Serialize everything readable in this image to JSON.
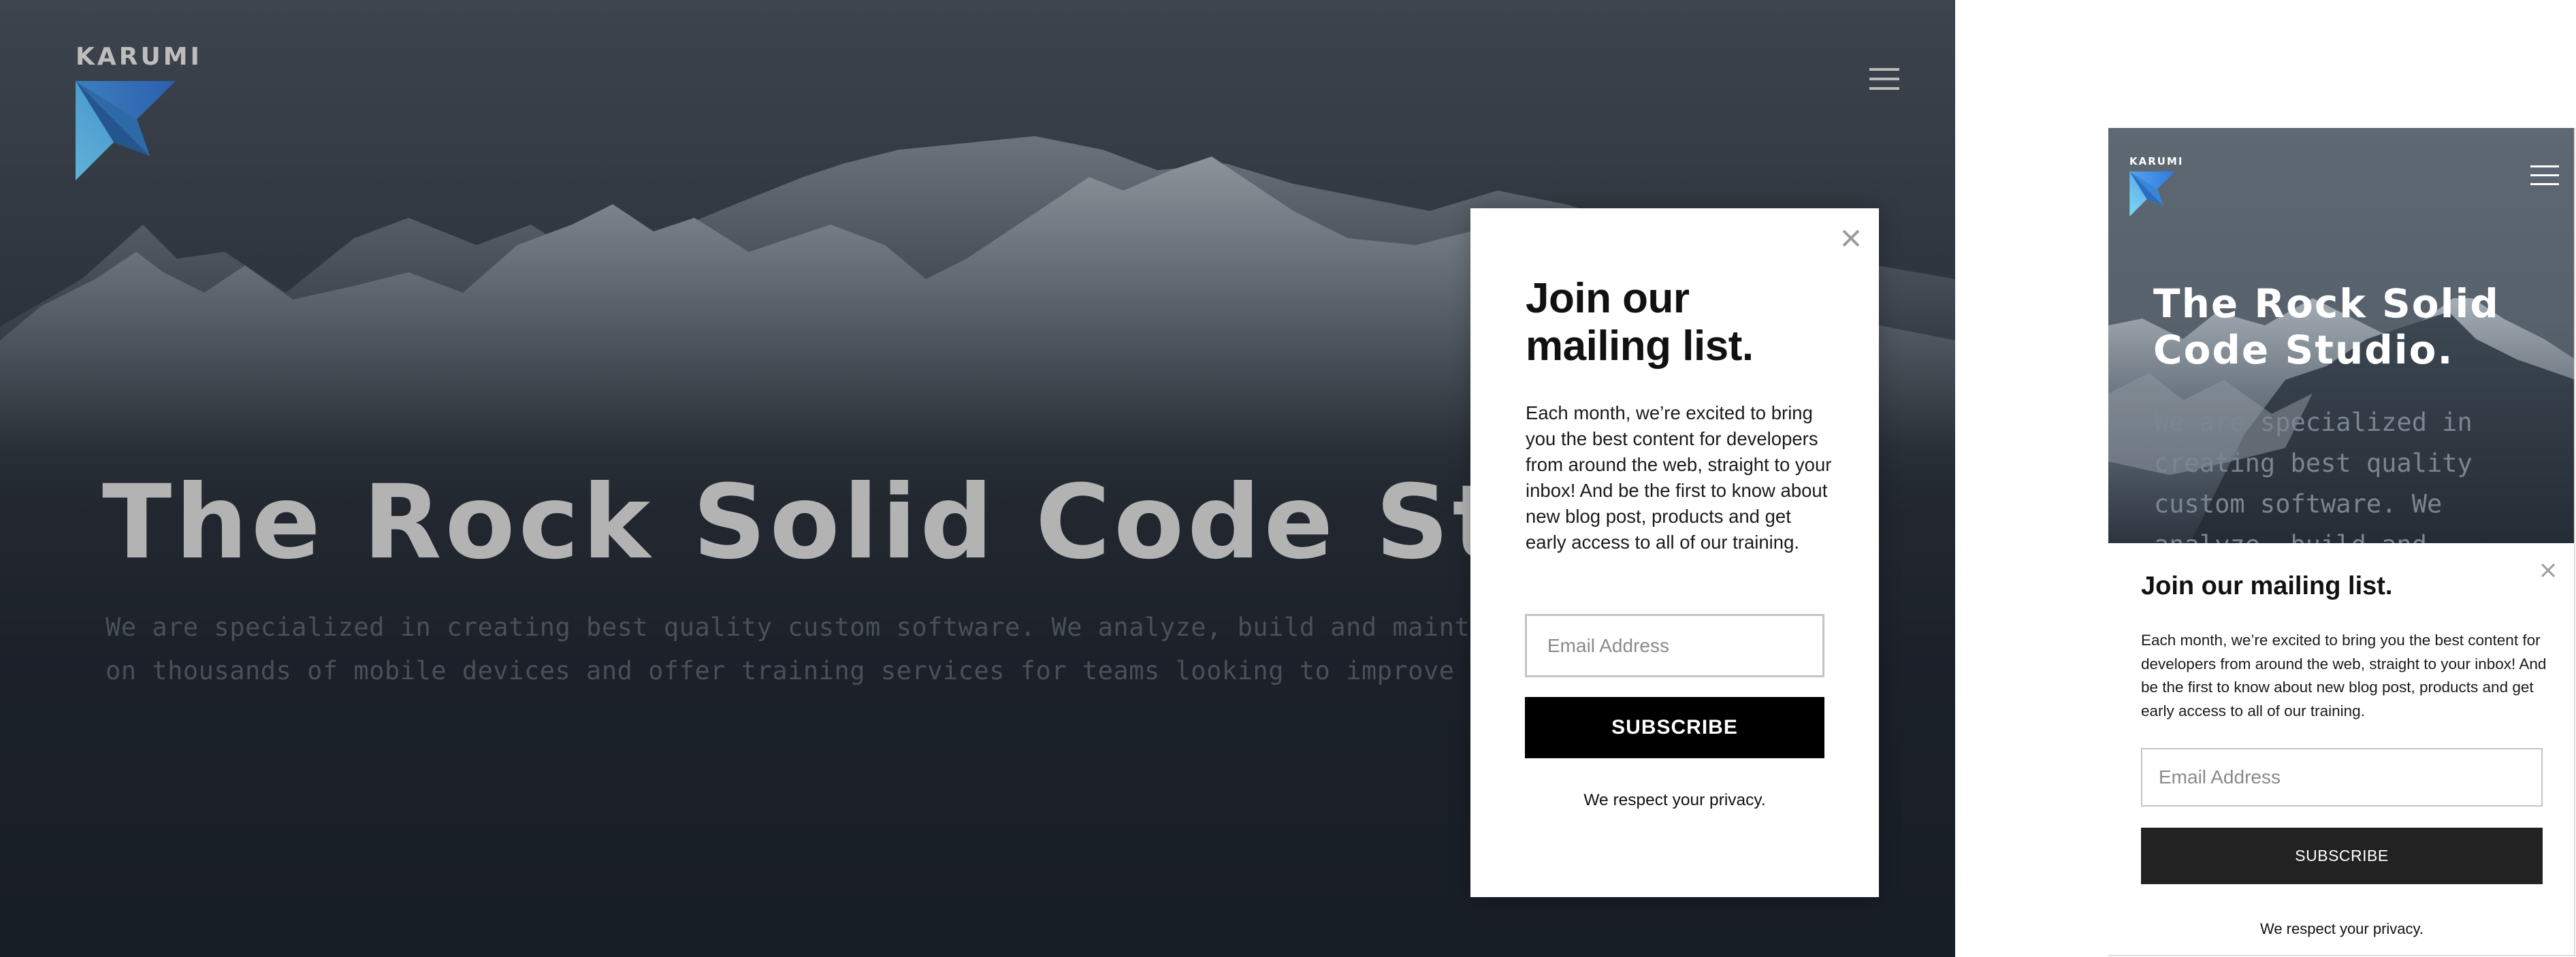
{
  "brand": {
    "name": "KARUMI",
    "colors": {
      "logo_light": "#7fd0ee",
      "logo_mid": "#3f8ad8",
      "logo_dark": "#2a5aa8"
    }
  },
  "desktop": {
    "logo_text": "KARUMI",
    "menu_icon": "hamburger-menu-icon",
    "hero": {
      "title": "The Rock Solid Code Studio.",
      "description": "We are specialized in creating best quality custom software. We analyze, build and maintain software that runs on thousands of mobile devices and offer training services for teams looking to improve their software skills."
    },
    "modal": {
      "close_icon": "close-icon",
      "title": "Join our mailing list.",
      "text": "Each month, we’re excited to bring you the best content for developers from around the web, straight to your inbox! And be the first to know about new blog post, products and get early access to all of our training.",
      "email_placeholder": "Email Address",
      "email_value": "",
      "subscribe_label": "SUBSCRIBE",
      "privacy_note": "We respect your privacy."
    }
  },
  "mobile": {
    "logo_text": "KARUMI",
    "menu_icon": "hamburger-menu-icon",
    "hero": {
      "title": "The Rock Solid Code Studio.",
      "description": "We are specialized in creating best quality custom software. We analyze, build and"
    },
    "modal": {
      "close_icon": "close-icon",
      "title": "Join our mailing list.",
      "text": "Each month, we’re excited to bring you the best content for developers from around the web, straight to your inbox! And be the first to know about new blog post, products and get early access to all of our training.",
      "email_placeholder": "Email Address",
      "email_value": "",
      "subscribe_label": "SUBSCRIBE",
      "privacy_note": "We respect your privacy."
    }
  }
}
